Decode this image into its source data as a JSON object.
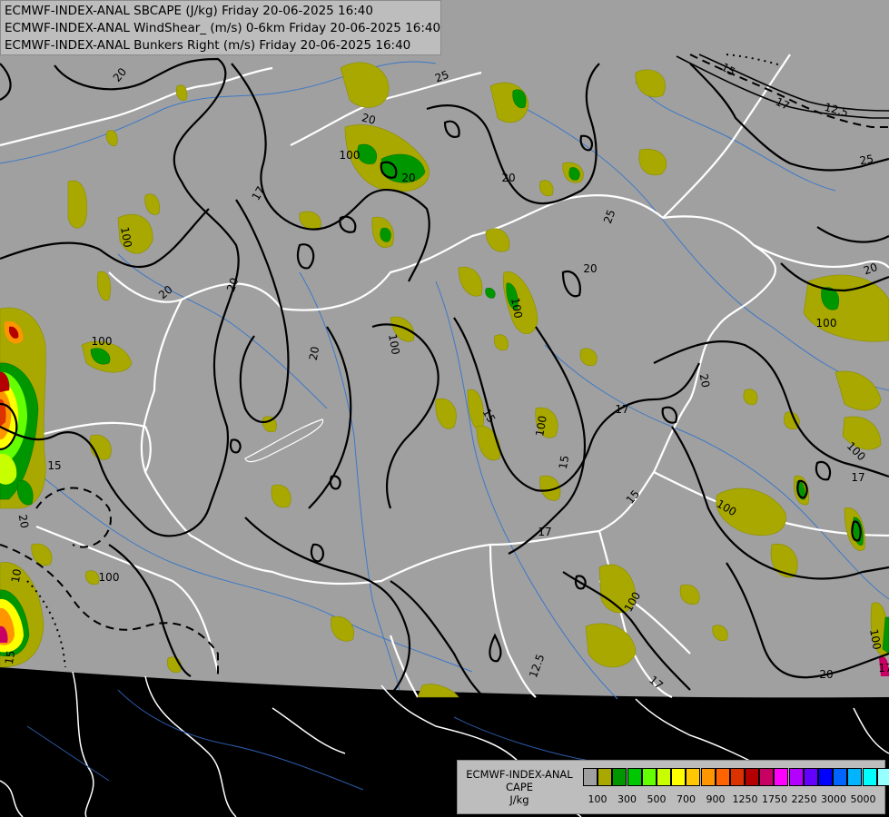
{
  "titles": [
    "ECMWF-INDEX-ANAL SBCAPE (J/kg) Friday 20-06-2025 16:40",
    "ECMWF-INDEX-ANAL WindShear_ (m/s) 0-6km Friday 20-06-2025 16:40",
    "ECMWF-INDEX-ANAL Bunkers Right (m/s) Friday 20-06-2025 16:40"
  ],
  "legend": {
    "title_lines": [
      "ECMWF-INDEX-ANAL",
      "CAPE",
      "J/kg"
    ],
    "swatch_colors": [
      "#a0a0a0",
      "#a8a800",
      "#009600",
      "#00c800",
      "#64ff00",
      "#c8ff00",
      "#ffff00",
      "#ffc800",
      "#ff9600",
      "#ff6400",
      "#dc3200",
      "#b40000",
      "#c80064",
      "#ff00ff",
      "#b400ff",
      "#6400ff",
      "#0000ff",
      "#0064ff",
      "#00b4ff",
      "#00ffff",
      "#96ffff",
      "#ffffff"
    ],
    "tick_labels": [
      "100",
      "300",
      "500",
      "700",
      "900",
      "1250",
      "1750",
      "2250",
      "3000",
      "5000"
    ]
  },
  "contour_labels": [
    "20",
    "25",
    "15",
    "17",
    "12.5",
    "25",
    "20",
    "17",
    "100",
    "20",
    "100",
    "20",
    "20",
    "100",
    "25",
    "20",
    "100",
    "100",
    "20",
    "100",
    "20",
    "15",
    "15",
    "100",
    "17",
    "20",
    "17",
    "100",
    "15",
    "17",
    "100",
    "15",
    "20",
    "100",
    "15",
    "12.5",
    "100",
    "17",
    "20",
    "100",
    "20",
    "17",
    "100",
    "10",
    "20"
  ],
  "colors": {
    "map_gray": "#a0a0a0",
    "outside": "#000000",
    "cape_100": "#a8a800",
    "cape_300": "#009600",
    "cape_500": "#00c800",
    "border": "#ffffff",
    "rivers": "#3c78c8",
    "shear_contour": "#000000"
  }
}
